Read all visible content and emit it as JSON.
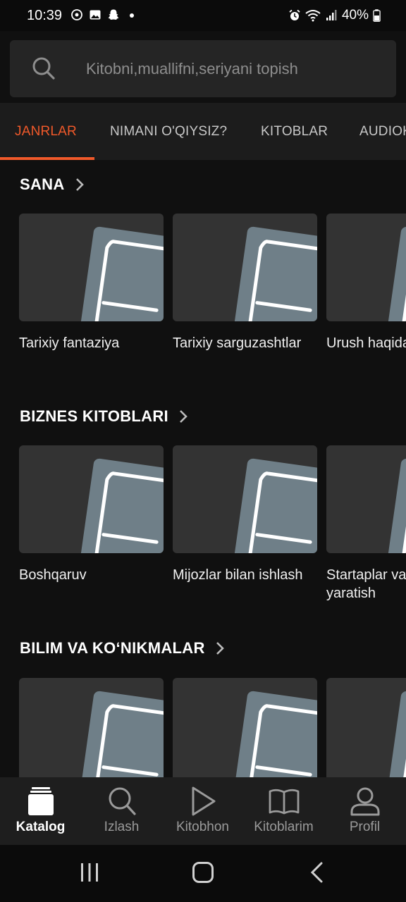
{
  "status_bar": {
    "time": "10:39",
    "battery": "40%",
    "left_icons": [
      "whatsapp-icon",
      "gallery-icon",
      "snapchat-icon",
      "dot-icon"
    ],
    "right_icons": [
      "alarm-icon",
      "wifi-icon",
      "signal-icon",
      "battery-icon"
    ]
  },
  "search": {
    "placeholder": "Kitobni,muallifni,seriyani topish"
  },
  "tabs": [
    {
      "label": "JANRLAR",
      "active": true
    },
    {
      "label": "NIMANI O'QIYSIZ?",
      "active": false
    },
    {
      "label": "KITOBLAR",
      "active": false
    },
    {
      "label": "AUDIOKITOBLAR",
      "active": false
    }
  ],
  "sections": [
    {
      "title": "SANA",
      "items": [
        {
          "title": "Tarixiy fantaziya"
        },
        {
          "title": "Tarixiy sarguzashtlar"
        },
        {
          "title": "Urush haqida kitoblar"
        }
      ]
    },
    {
      "title": "BIZNES KITOBLARI",
      "items": [
        {
          "title": "Boshqaruv"
        },
        {
          "title": "Mijozlar bilan ishlash"
        },
        {
          "title": "Startaplar va biznes yaratish"
        }
      ]
    },
    {
      "title": "BILIM VA KOʻNIKMALAR",
      "items": [
        {
          "title": ""
        },
        {
          "title": ""
        },
        {
          "title": ""
        }
      ]
    }
  ],
  "bottom_nav": [
    {
      "label": "Katalog",
      "icon": "catalog-icon",
      "active": true
    },
    {
      "label": "Izlash",
      "icon": "search-icon",
      "active": false
    },
    {
      "label": "Kitobhon",
      "icon": "play-icon",
      "active": false
    },
    {
      "label": "Kitoblarim",
      "icon": "book-icon",
      "active": false
    },
    {
      "label": "Profil",
      "icon": "profile-icon",
      "active": false
    }
  ],
  "colors": {
    "accent": "#f0592a",
    "background": "#101010",
    "card_cover": "#333333",
    "placeholder_book": "#6f7f88"
  }
}
